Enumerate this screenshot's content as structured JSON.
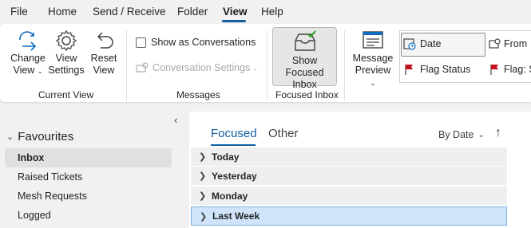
{
  "menu": {
    "items": [
      "File",
      "Home",
      "Send / Receive",
      "Folder",
      "View",
      "Help"
    ],
    "active": "View"
  },
  "ribbon": {
    "current_view": {
      "change_view": [
        "Change",
        "View"
      ],
      "view_settings": [
        "View",
        "Settings"
      ],
      "reset_view": [
        "Reset",
        "View"
      ],
      "label": "Current View"
    },
    "messages": {
      "show_as_conversations": "Show as Conversations",
      "conversation_settings": "Conversation Settings",
      "label": "Messages"
    },
    "focused_inbox": {
      "button": [
        "Show Focused",
        "Inbox"
      ],
      "label": "Focused Inbox"
    },
    "layout": {
      "message_preview": [
        "Message",
        "Preview"
      ]
    },
    "arrangement": {
      "date": "Date",
      "from": "From",
      "flag_status": "Flag Status",
      "flag_start": "Flag: S"
    }
  },
  "folders": {
    "collapse_glyph": "‹",
    "favourites": "Favourites",
    "items": [
      "Inbox",
      "Raised Tickets",
      "Mesh Requests",
      "Logged"
    ],
    "selected": "Inbox"
  },
  "message_list": {
    "tabs": [
      "Focused",
      "Other"
    ],
    "sort_label": "By Date",
    "sort_arrow": "↑",
    "groups": [
      "Today",
      "Yesterday",
      "Monday",
      "Last Week"
    ],
    "selected_group": "Last Week"
  },
  "colors": {
    "accent": "#115ea3",
    "selection": "#cfe4fa",
    "flag_red": "#c50f1f"
  }
}
